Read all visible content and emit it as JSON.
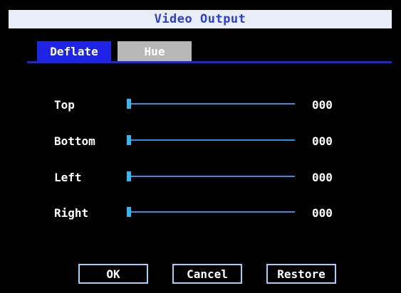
{
  "window": {
    "title": "Video Output"
  },
  "tabs": [
    {
      "label": "Deflate",
      "active": true
    },
    {
      "label": "Hue",
      "active": false
    }
  ],
  "rows": [
    {
      "label": "Top",
      "value": "000",
      "level": 0
    },
    {
      "label": "Bottom",
      "value": "000",
      "level": 0
    },
    {
      "label": "Left",
      "value": "000",
      "level": 0
    },
    {
      "label": "Right",
      "value": "000",
      "level": 0
    }
  ],
  "buttons": {
    "ok": "OK",
    "cancel": "Cancel",
    "restore": "Restore"
  },
  "colors": {
    "background": "#000000",
    "title_bar": "#e9edf7",
    "title_text": "#2a3fd6",
    "tab_active": "#1d24e6",
    "tab_inactive": "#b7b7b7",
    "slider": "#2f8fe0",
    "button_border": "#9fd0ff"
  }
}
